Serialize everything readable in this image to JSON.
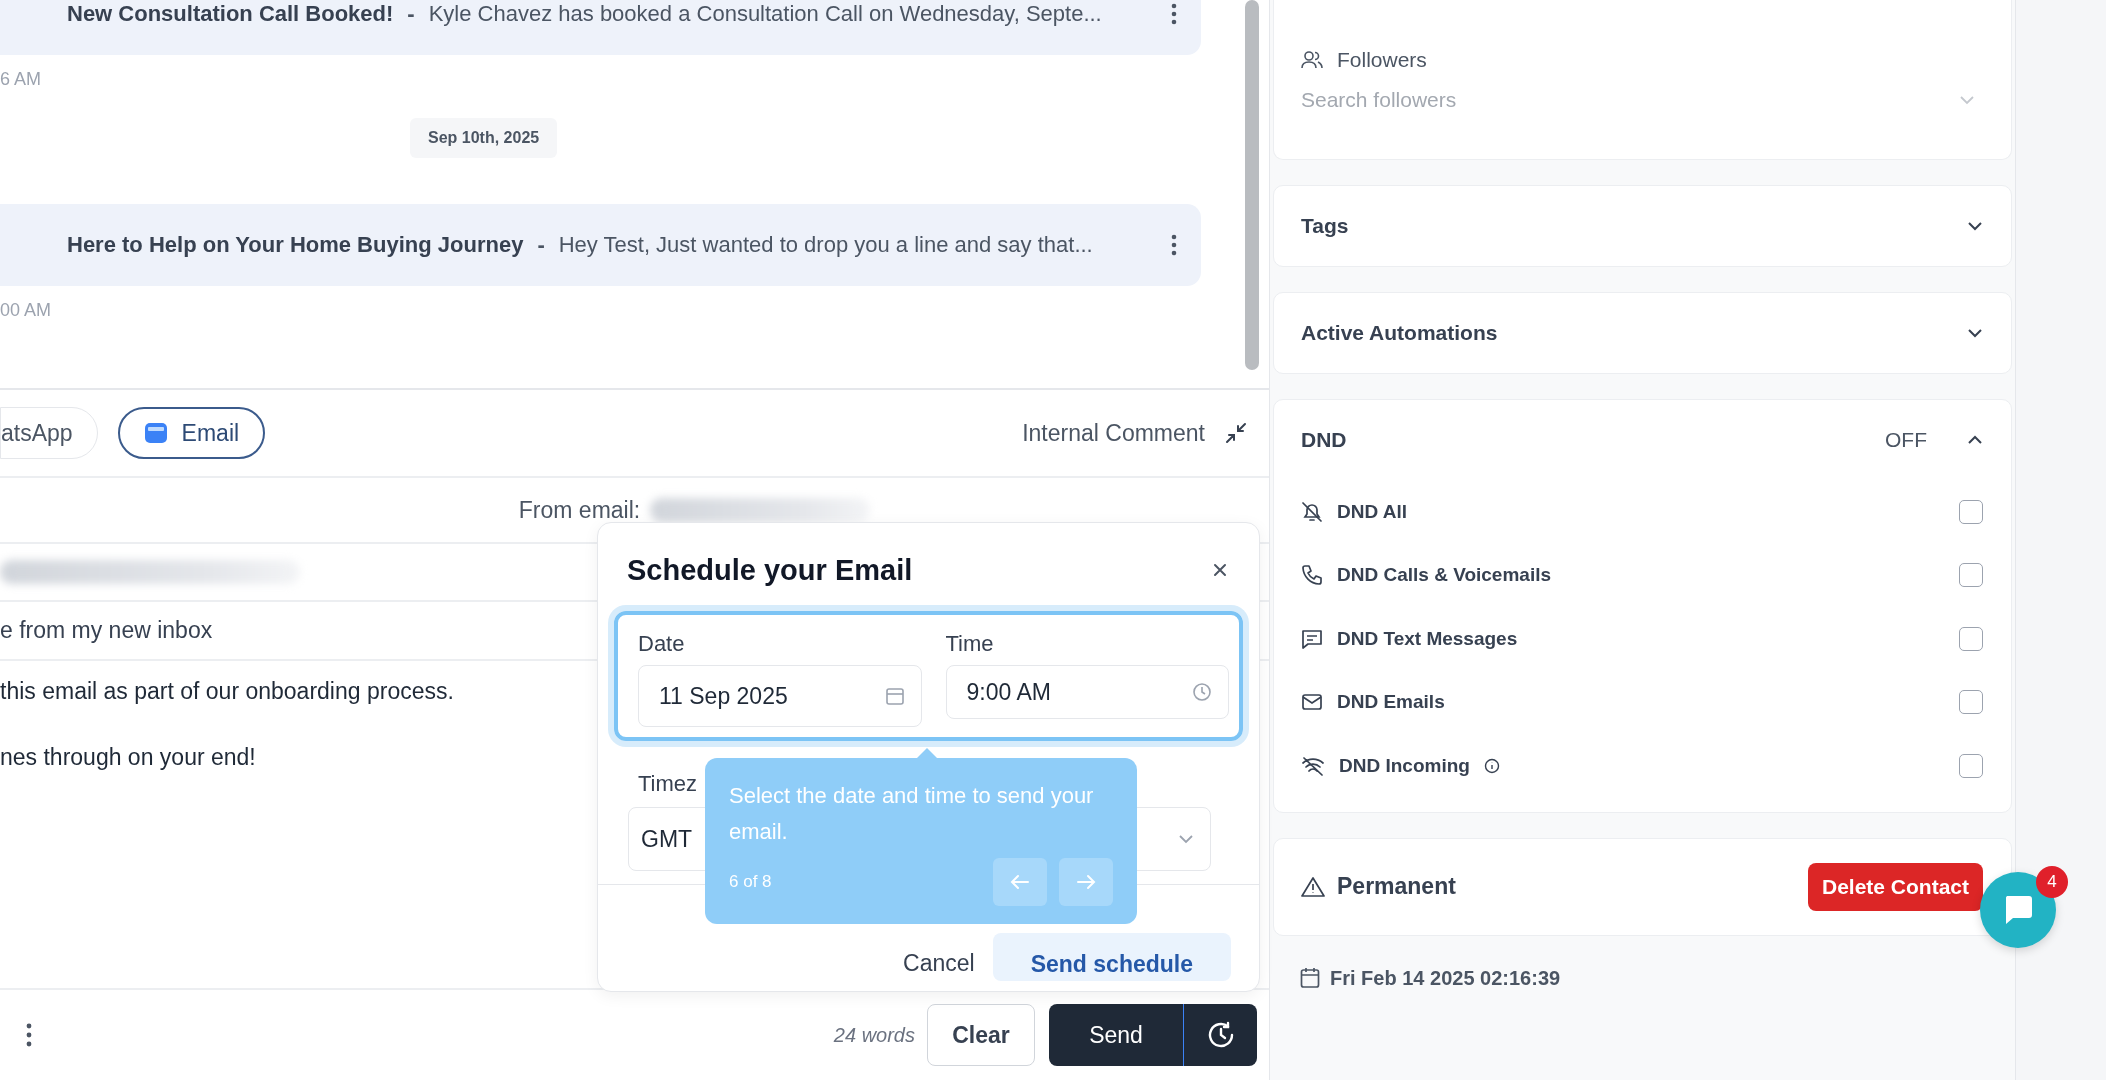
{
  "messages": [
    {
      "title": "New Consultation Call Booked!",
      "separator": "-",
      "preview": "Kyle Chavez has booked a Consultation Call on Wednesday, Septe...",
      "time": "6 AM"
    },
    {
      "title": "Here to Help on Your Home Buying Journey",
      "separator": "-",
      "preview": "Hey Test, Just wanted to drop you a line and say that...",
      "time": "00 AM",
      "date": "Sep 10th, 2025"
    }
  ],
  "composer": {
    "channels": [
      {
        "label": "atsApp",
        "kind": "whatsapp",
        "selected": false
      },
      {
        "label": "Email",
        "kind": "email",
        "selected": true
      }
    ],
    "internal_comment": "Internal Comment",
    "from_label": "From email:",
    "subject": "e from my new inbox",
    "body": [
      "this email as part of our onboarding process.",
      "nes through on your end!"
    ],
    "word_count": "24 words",
    "clear": "Clear",
    "send": "Send"
  },
  "schedule_dialog": {
    "title": "Schedule your Email",
    "date_label": "Date",
    "date_value": "11 Sep 2025",
    "time_label": "Time",
    "time_value": "9:00 AM",
    "timezone_label": "Timez",
    "timezone_value": "GMT",
    "cancel": "Cancel",
    "confirm": "Send schedule"
  },
  "tour_tip": {
    "text": "Select the date and time to send your email.",
    "step": "6 of 8"
  },
  "sidebar": {
    "followers": {
      "label": "Followers",
      "placeholder": "Search followers"
    },
    "sections": [
      {
        "title": "Tags",
        "expanded": false
      },
      {
        "title": "Active Automations",
        "expanded": false
      }
    ],
    "dnd": {
      "title": "DND",
      "status": "OFF",
      "expanded": true,
      "options": [
        {
          "label": "DND All",
          "kind": "all",
          "info": false,
          "checked": false
        },
        {
          "label": "DND Calls & Voicemails",
          "kind": "calls",
          "info": false,
          "checked": false
        },
        {
          "label": "DND Text Messages",
          "kind": "text",
          "info": false,
          "checked": false
        },
        {
          "label": "DND Emails",
          "kind": "email",
          "info": false,
          "checked": false
        },
        {
          "label": "DND Incoming",
          "kind": "incoming",
          "info": true,
          "checked": false
        }
      ]
    },
    "permanent": {
      "title": "Permanent",
      "button": "Delete Contact"
    },
    "created": "Fri Feb 14 2025 02:16:39"
  },
  "chat_badge": "4"
}
